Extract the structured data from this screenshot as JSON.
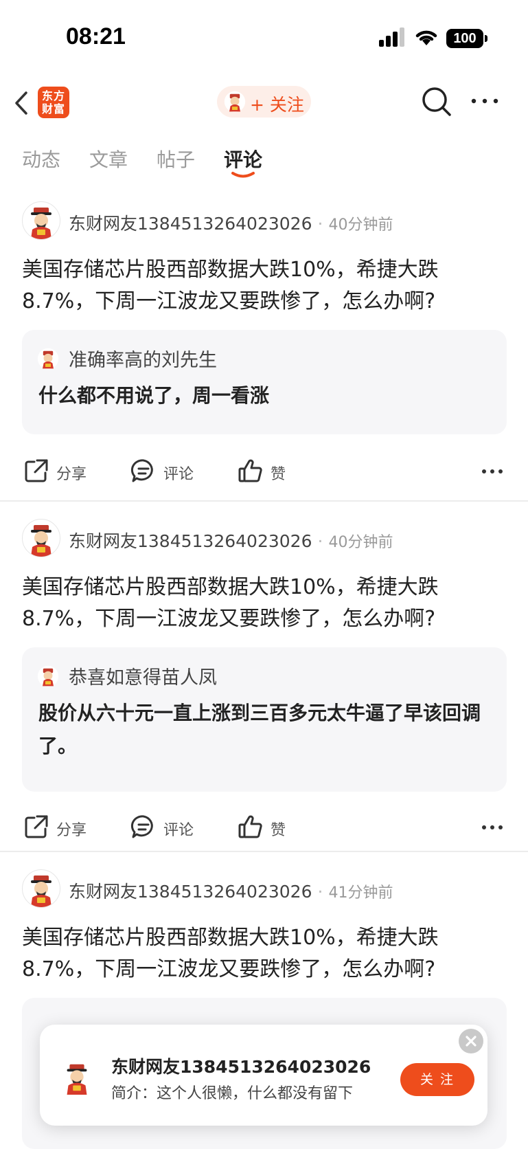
{
  "status": {
    "time": "08:21",
    "battery": "100"
  },
  "header": {
    "logo_line1": "东方",
    "logo_line2": "财富",
    "follow_label": "+ 关注"
  },
  "tabs": [
    {
      "label": "动态",
      "active": false
    },
    {
      "label": "文章",
      "active": false
    },
    {
      "label": "帖子",
      "active": false
    },
    {
      "label": "评论",
      "active": true
    }
  ],
  "posts": [
    {
      "username": "东财网友1384513264023026",
      "time": "40分钟前",
      "text": "美国存储芯片股西部数据大跌10%，希捷大跌8.7%，下周一江波龙又要跌惨了，怎么办啊?",
      "quote_user": "准确率高的刘先生",
      "quote_text": "什么都不用说了，周一看涨"
    },
    {
      "username": "东财网友1384513264023026",
      "time": "40分钟前",
      "text": "美国存储芯片股西部数据大跌10%，希捷大跌8.7%，下周一江波龙又要跌惨了，怎么办啊?",
      "quote_user": "恭喜如意得苗人凤",
      "quote_text": "股价从六十元一直上涨到三百多元太牛逼了早该回调了。"
    },
    {
      "username": "东财网友1384513264023026",
      "time": "41分钟前",
      "text": "美国存储芯片股西部数据大跌10%，希捷大跌8.7%，下周一江波龙又要跌惨了，怎么办啊?"
    }
  ],
  "actions": {
    "share": "分享",
    "comment": "评论",
    "like": "赞"
  },
  "popup": {
    "name": "东财网友1384513264023026",
    "bio": "简介：这个人很懒，什么都没有留下",
    "follow": "关 注"
  },
  "colors": {
    "accent": "#ee4d1c",
    "quote_bg": "#f6f6f8"
  }
}
